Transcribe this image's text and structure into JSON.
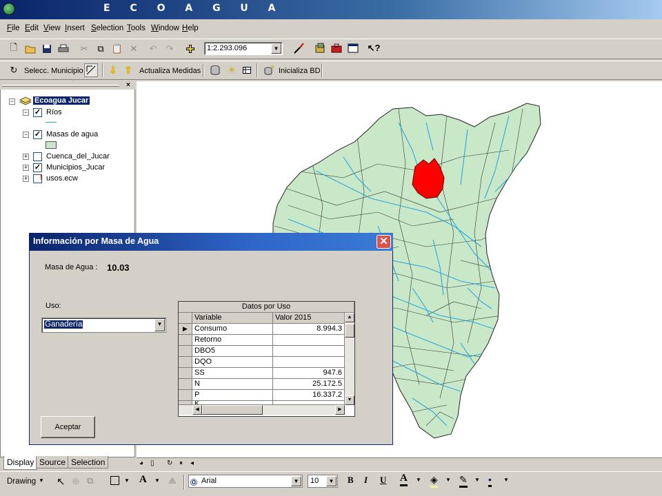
{
  "window": {
    "title": "E C O A G U A"
  },
  "menu": [
    "File",
    "Edit",
    "View",
    "Insert",
    "Selection",
    "Tools",
    "Window",
    "Help"
  ],
  "toolbar": {
    "scale": "1:2.293.096"
  },
  "custom_toolbar": {
    "select_municipio": "Selecc. Municipio",
    "actualiza_medidas": "Actualiza Medidas",
    "inicializa_bd": "Inicializa BD"
  },
  "toc": {
    "root": "Ecoagua Jucar",
    "layers": [
      "Ríos",
      "Masas de agua",
      "Cuenca_del_Jucar",
      "Municipios_Jucar",
      "usos.ecw"
    ],
    "checked": [
      true,
      true,
      false,
      true,
      false
    ],
    "tabs": [
      "Display",
      "Source",
      "Selection"
    ]
  },
  "dialog": {
    "title": "Información por Masa de Agua",
    "masa_label": "Masa de Agua :",
    "masa_value": "10.03",
    "uso_label": "Uso:",
    "uso_value": "Ganadería",
    "grid_title": "Datos por Uso",
    "col_variable": "Variable",
    "col_valor": "Valor 2015",
    "rows": [
      {
        "variable": "Consumo",
        "valor": "8.994.3"
      },
      {
        "variable": "Retorno",
        "valor": ""
      },
      {
        "variable": "DBO5",
        "valor": ""
      },
      {
        "variable": "DQO",
        "valor": ""
      },
      {
        "variable": "SS",
        "valor": "947.6"
      },
      {
        "variable": "N",
        "valor": "25.172.5"
      },
      {
        "variable": "P",
        "valor": "16.337.2"
      },
      {
        "variable": "K",
        "valor": ""
      }
    ],
    "accept": "Aceptar"
  },
  "drawing_bar": {
    "drawing": "Drawing",
    "font": "Arial",
    "size": "10",
    "bold": "B",
    "italic": "I",
    "underline": "U",
    "font_color": "A"
  },
  "colors": {
    "map_fill": "#c8e8c8",
    "rivers": "#2aa6e0",
    "selected": "#ff0000",
    "titlebar": "#0a246a"
  }
}
